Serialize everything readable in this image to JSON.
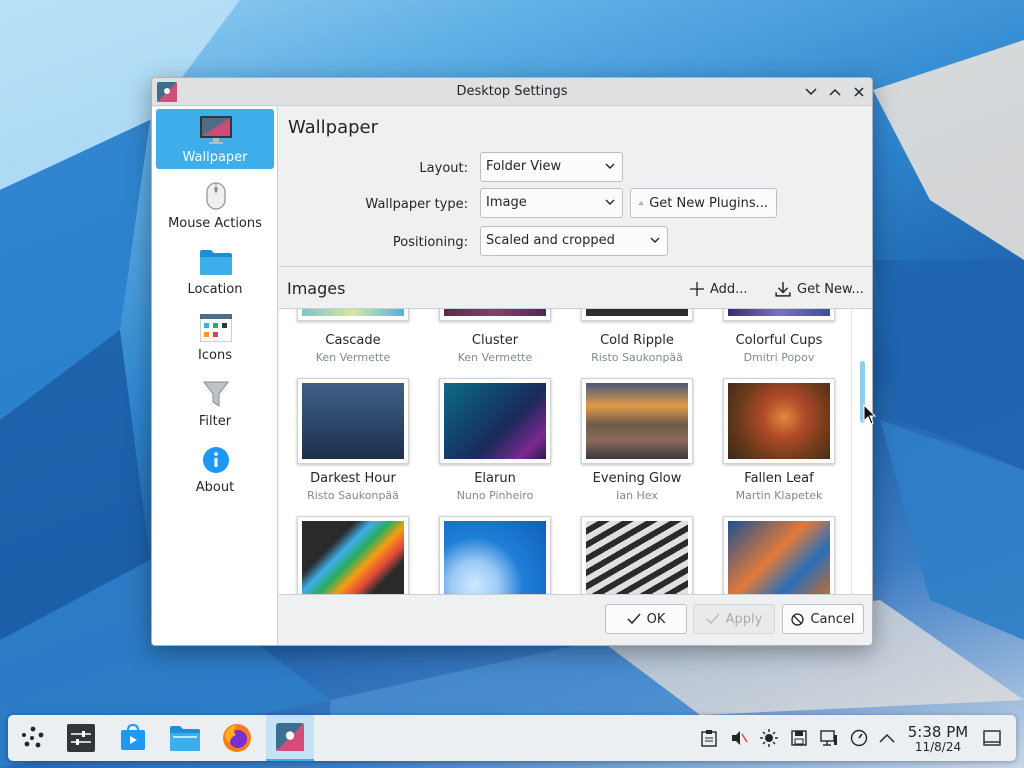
{
  "window": {
    "title": "Desktop Settings"
  },
  "sidebar": {
    "items": [
      {
        "label": "Wallpaper",
        "icon": "monitor-icon",
        "active": true
      },
      {
        "label": "Mouse Actions",
        "icon": "mouse-icon"
      },
      {
        "label": "Location",
        "icon": "folder-icon"
      },
      {
        "label": "Icons",
        "icon": "icons-icon"
      },
      {
        "label": "Filter",
        "icon": "filter-icon"
      },
      {
        "label": "About",
        "icon": "info-icon"
      }
    ]
  },
  "wallpaper": {
    "title": "Wallpaper",
    "layout_label": "Layout:",
    "layout_value": "Folder View",
    "type_label": "Wallpaper type:",
    "type_value": "Image",
    "get_plugins_label": "Get New Plugins...",
    "positioning_label": "Positioning:",
    "positioning_value": "Scaled and cropped"
  },
  "images": {
    "title": "Images",
    "add_label": "Add...",
    "get_new_label": "Get New...",
    "items": [
      {
        "name": "Cascade",
        "author": "Ken Vermette"
      },
      {
        "name": "Cluster",
        "author": "Ken Vermette"
      },
      {
        "name": "Cold Ripple",
        "author": "Risto Saukonpää"
      },
      {
        "name": "Colorful Cups",
        "author": "Dmitri Popov"
      },
      {
        "name": "Darkest Hour",
        "author": "Risto Saukonpää"
      },
      {
        "name": "Elarun",
        "author": "Nuno Pinheiro"
      },
      {
        "name": "Evening Glow",
        "author": "Ian Hex"
      },
      {
        "name": "Fallen Leaf",
        "author": "Martin Klapetek"
      }
    ]
  },
  "footer": {
    "ok_label": "OK",
    "apply_label": "Apply",
    "cancel_label": "Cancel"
  },
  "taskbar": {
    "time": "5:38 PM",
    "date": "11/8/24"
  },
  "colors": {
    "accent": "#3daee9",
    "window_bg": "#eff0f1"
  }
}
